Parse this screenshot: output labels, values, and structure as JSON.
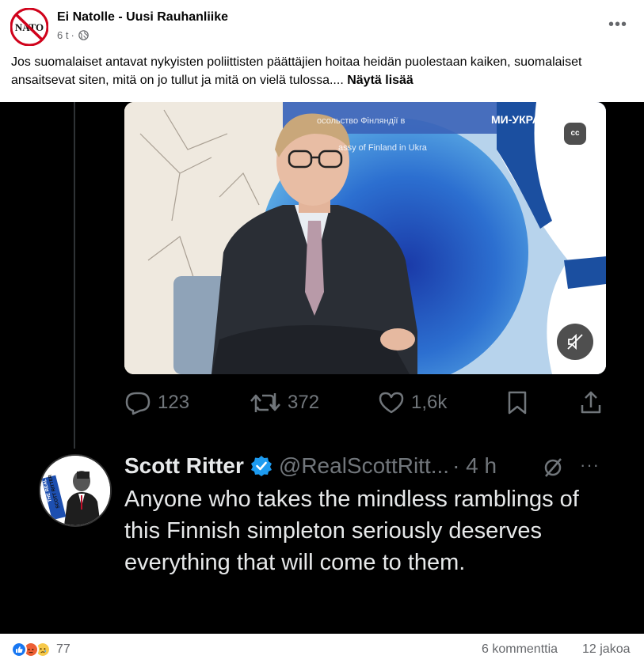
{
  "post": {
    "author": "Ei Natolle - Uusi Rauhanliike",
    "time": "6 t",
    "separator": "·",
    "avatar_text": "NATO",
    "more_label": "•••",
    "caption": "Jos suomalaiset antavat nykyisten poliittisten päättäjien hoitaa heidän puolestaan kaiken, suomalaiset ansaitsevat siten, mitä on jo tullut ja mitä on vielä tulossa....",
    "see_more": "Näytä lisää"
  },
  "video": {
    "banner_top": "осольство Фінляндії в",
    "banner_bottom": "assy of Finland in Ukra",
    "banner_right": "МИ-УКРАЇНА",
    "cc_label": "cc"
  },
  "tweet_actions": {
    "replies": "123",
    "retweets": "372",
    "likes": "1,6k"
  },
  "tweet": {
    "name": "Scott Ritter",
    "handle": "@RealScottRitt...",
    "time": "· 4 h",
    "more": "···",
    "avatar_text_top": "THE REAL",
    "avatar_text_bottom": "SCOTT RITTER",
    "text": "Anyone who takes the mindless ramblings of this Finnish simpleton seriously deserves everything that will come to them."
  },
  "footer": {
    "reaction_count": "77",
    "comments": "6 kommenttia",
    "shares": "12 jakoa"
  },
  "colors": {
    "facebook_blue": "#1877f2",
    "twitter_blue": "#1d9bf0",
    "nato_red": "#d0021b",
    "muted_text": "#65676b",
    "tweet_text": "#e7e9ea",
    "tweet_muted": "#71767b"
  }
}
